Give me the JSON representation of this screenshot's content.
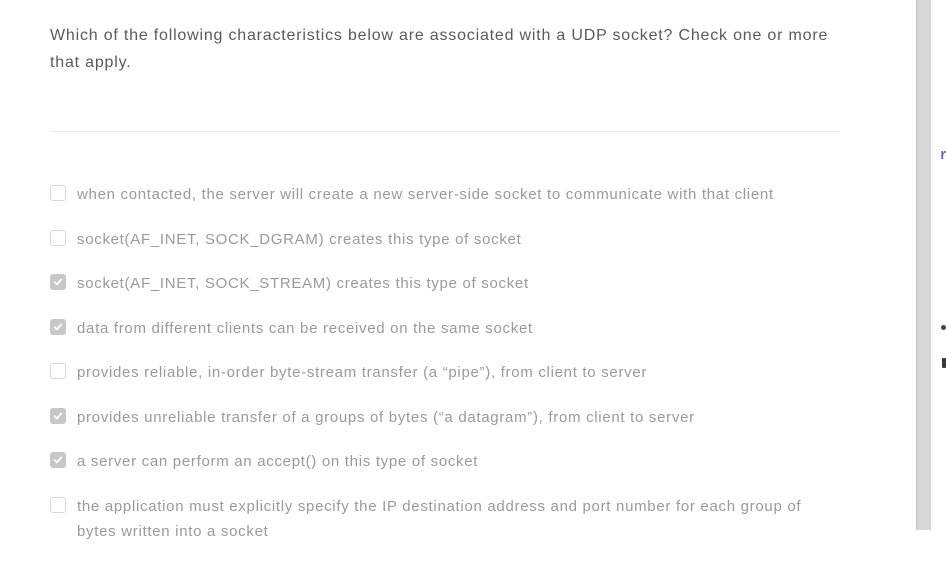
{
  "question": "Which of the following characteristics below are associated with a UDP socket? Check one or more that apply.",
  "options": [
    {
      "checked": false,
      "text": "when contacted, the server will create a new server-side socket to communicate with that client"
    },
    {
      "checked": false,
      "text": "socket(AF_INET, SOCK_DGRAM) creates this type of socket"
    },
    {
      "checked": true,
      "text": "socket(AF_INET, SOCK_STREAM) creates this type of socket"
    },
    {
      "checked": true,
      "text": "data from different clients can be received on the same socket"
    },
    {
      "checked": false,
      "text": "provides reliable, in-order byte-stream transfer (a “pipe”), from client to server"
    },
    {
      "checked": true,
      "text": "provides unreliable transfer of a groups of bytes (“a datagram”), from client to server"
    },
    {
      "checked": true,
      "text": "a server can perform an accept() on this type of socket"
    },
    {
      "checked": false,
      "text": "the application must explicitly specify the IP destination address and port number for each group of bytes written into a socket"
    }
  ]
}
